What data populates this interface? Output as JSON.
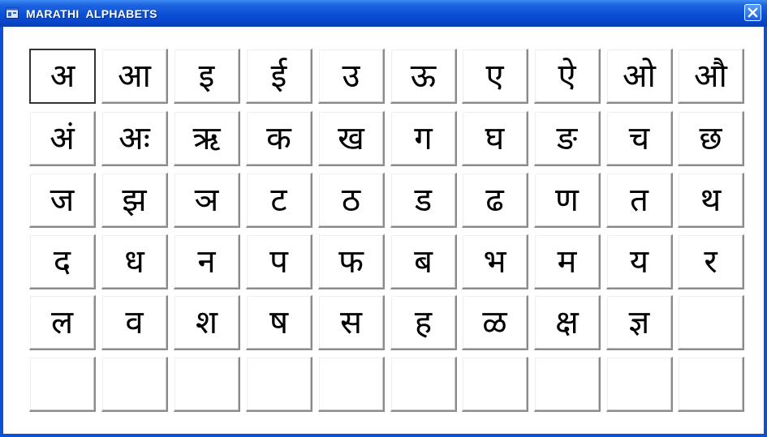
{
  "window": {
    "title": "MARATHI  ALPHABETS",
    "icon": "app-window-icon",
    "close_icon": "close-icon"
  },
  "alphabet": {
    "selected_index": 0,
    "letters": [
      "अ",
      "आ",
      "इ",
      "ई",
      "उ",
      "ऊ",
      "ए",
      "ऐ",
      "ओ",
      "औ",
      "अं",
      "अः",
      "ऋ",
      "क",
      "ख",
      "ग",
      "घ",
      "ङ",
      "च",
      "छ",
      "ज",
      "झ",
      "ञ",
      "ट",
      "ठ",
      "ड",
      "ढ",
      "ण",
      "त",
      "थ",
      "द",
      "ध",
      "न",
      "प",
      "फ",
      "ब",
      "भ",
      "म",
      "य",
      "र",
      "ल",
      "व",
      "श",
      "ष",
      "स",
      "ह",
      "ळ",
      "क्ष",
      "ज्ञ",
      "",
      "",
      "",
      "",
      "",
      "",
      "",
      "",
      "",
      "",
      ""
    ]
  }
}
